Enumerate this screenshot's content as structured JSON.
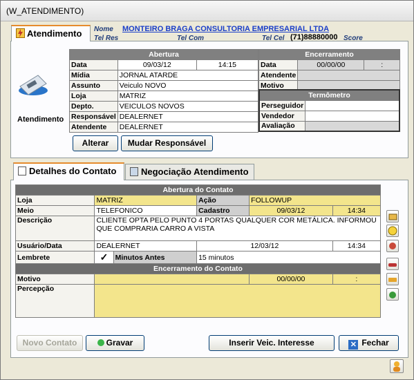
{
  "window": {
    "title": "(W_ATENDIMENTO)"
  },
  "top_tab": {
    "label": "Atendimento"
  },
  "header": {
    "nome_label": "Nome",
    "nome_value": "MONTEIRO BRAGA CONSULTORIA EMPRESARIAL LTDA",
    "telres_label": "Tel Res",
    "telcom_label": "Tel Com",
    "telcel_label": "Tel Cel",
    "telcel_value": "(71)88880000",
    "score_label": "Score"
  },
  "atendimento_caption": "Atendimento",
  "abertura": {
    "title": "Abertura",
    "data_label": "Data",
    "data_value": "09/03/12",
    "hora_value": "14:15",
    "midia_label": "Mídia",
    "midia_value": "JORNAL ATARDE",
    "assunto_label": "Assunto",
    "assunto_value": "Veiculo NOVO",
    "loja_label": "Loja",
    "loja_value": "MATRIZ",
    "depto_label": "Depto.",
    "depto_value": "VEICULOS NOVOS",
    "responsavel_label": "Responsável",
    "responsavel_value": "DEALERNET",
    "atendente_label": "Atendente",
    "atendente_value": "DEALERNET"
  },
  "encerramento": {
    "title": "Encerramento",
    "data_label": "Data",
    "data_value": "00/00/00",
    "hora_value": ":",
    "atendente_label": "Atendente",
    "motivo_label": "Motivo"
  },
  "termometro": {
    "title": "Termômetro",
    "perseguidor_label": "Perseguidor",
    "vendedor_label": "Vendedor",
    "avaliacao_label": "Avaliação"
  },
  "buttons_top": {
    "alterar": "Alterar",
    "mudar_responsavel": "Mudar Responsável"
  },
  "bottom_tabs": {
    "detalhes": "Detalhes do Contato",
    "negociacao": "Negociação Atendimento"
  },
  "contato": {
    "abertura_title": "Abertura do Contato",
    "loja_label": "Loja",
    "loja_value": "MATRIZ",
    "acao_label": "Ação",
    "acao_value": "FOLLOWUP",
    "meio_label": "Meio",
    "meio_value": "TELEFONICO",
    "cadastro_label": "Cadastro",
    "cadastro_date": "09/03/12",
    "cadastro_time": "14:34",
    "descricao_label": "Descrição",
    "descricao_line1": "CLIENTE OPTA PELO PUNTO 4 PORTAS  QUALQUER COR METÁLICA. INFORMOU",
    "descricao_line2": "QUE COMPRARIA CARRO A VISTA",
    "usuario_label": "Usuário/Data",
    "usuario_value": "DEALERNET",
    "usuario_date": "12/03/12",
    "usuario_time": "14:34",
    "lembrete_label": "Lembrete",
    "minutos_label": "Minutos Antes",
    "minutos_value": "15 minutos",
    "encerramento_title": "Encerramento do Contato",
    "motivo_label": "Motivo",
    "motivo_date": "00/00/00",
    "motivo_time": ":",
    "percepcao_label": "Percepção"
  },
  "buttons_bottom": {
    "novo_contato": "Novo Contato",
    "gravar": "Gravar",
    "inserir": "Inserir Veic. Interesse",
    "fechar": "Fechar"
  }
}
